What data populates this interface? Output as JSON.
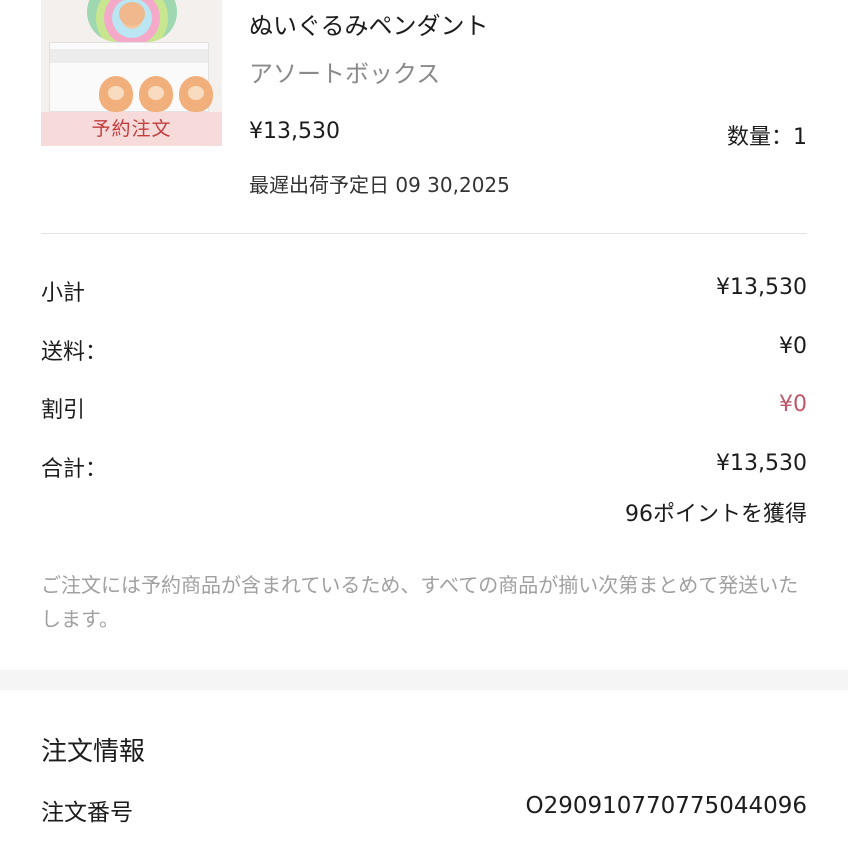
{
  "product": {
    "badge": "予約注文",
    "name": "ぬいぐるみペンダント",
    "variant": "アソートボックス",
    "price": "¥13,530",
    "quantity": "数量：1",
    "ship_date": "最遅出荷予定日 09 30,2025"
  },
  "summary": {
    "subtotal_label": "小計",
    "subtotal_value": "¥13,530",
    "shipping_label": "送料：",
    "shipping_value": "¥0",
    "discount_label": "割引",
    "discount_value": "¥0",
    "total_label": "合計：",
    "total_value": "¥13,530",
    "points": "96ポイントを獲得"
  },
  "notice": "ご注文には予約商品が含まれているため、すべての商品が揃い次第まとめて発送いたします。",
  "order_info": {
    "title": "注文情報",
    "order_number_label": "注文番号",
    "order_number_value": "O290910770775044096"
  },
  "colors": {
    "badge_bg": "#f7dbdb",
    "badge_text": "#c23e3e",
    "discount": "#c0566a",
    "muted": "#8a8a8a"
  }
}
